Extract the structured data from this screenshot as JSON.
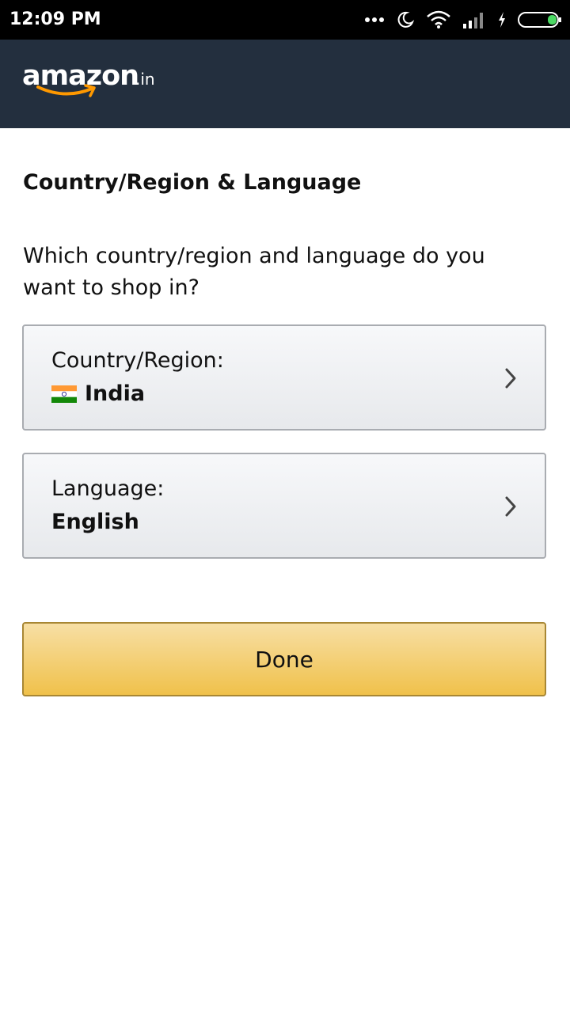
{
  "status_bar": {
    "time": "12:09 PM",
    "icons": [
      "more-dots-icon",
      "moon-icon",
      "wifi-icon",
      "signal-icon",
      "charging-icon",
      "battery-icon"
    ],
    "battery_color": "#4cd964"
  },
  "header": {
    "logo_word": "amazon",
    "logo_tld": ".in",
    "background": "#232f3e",
    "smile_color": "#ff9900"
  },
  "main": {
    "title": "Country/Region & Language",
    "prompt": "Which country/region and language do you want to shop in?",
    "country": {
      "label": "Country/Region:",
      "value": "India",
      "flag_icon": "india-flag-icon"
    },
    "language": {
      "label": "Language:",
      "value": "English"
    },
    "done_label": "Done",
    "button_color": "#f0c14b"
  }
}
